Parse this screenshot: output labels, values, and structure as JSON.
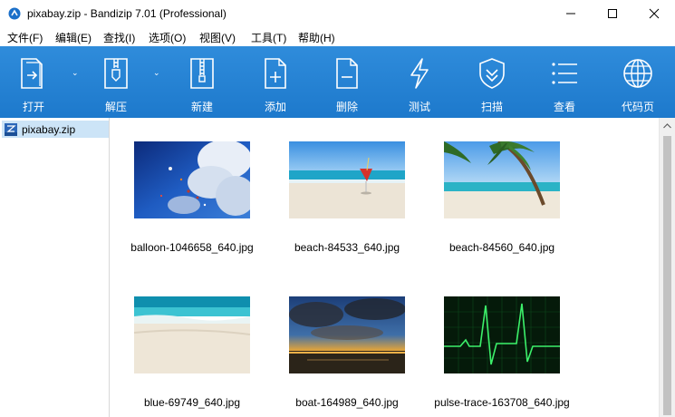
{
  "window": {
    "title": "pixabay.zip - Bandizip 7.01 (Professional)",
    "minimize_label": "minimize",
    "maximize_label": "maximize",
    "close_label": "close"
  },
  "menu": [
    "文件(F)",
    "编辑(E)",
    "查找(I)",
    "选项(O)",
    "视图(V)",
    "工具(T)",
    "帮助(H)"
  ],
  "toolbar": {
    "open": "打开",
    "extract": "解压",
    "new": "新建",
    "add": "添加",
    "delete": "删除",
    "test": "测试",
    "scan": "扫描",
    "view": "查看",
    "codepage": "代码页"
  },
  "tree": {
    "root_label": "pixabay.zip"
  },
  "files": [
    {
      "name": "balloon-1046658_640.jpg"
    },
    {
      "name": "beach-84533_640.jpg"
    },
    {
      "name": "beach-84560_640.jpg"
    },
    {
      "name": "blue-69749_640.jpg"
    },
    {
      "name": "boat-164989_640.jpg"
    },
    {
      "name": "pulse-trace-163708_640.jpg"
    }
  ],
  "colors": {
    "toolbar": "#2484d6",
    "selection": "#cce4f7"
  }
}
